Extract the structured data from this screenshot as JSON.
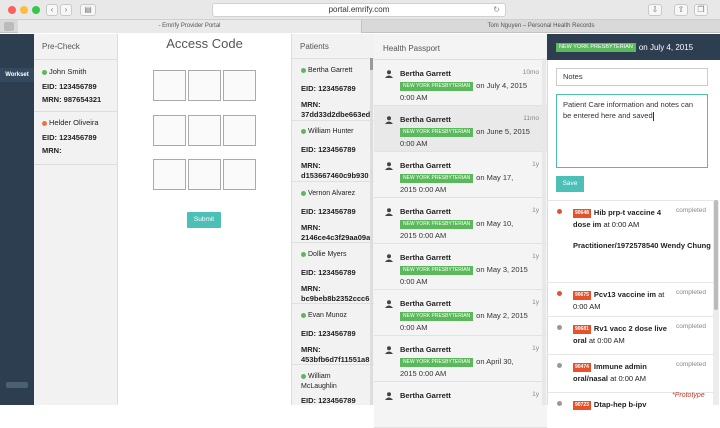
{
  "browser": {
    "url": "portal.emrify.com",
    "tabs": [
      "- Emrify Provider Portal",
      "Tom Nguyen – Personal Health Records"
    ]
  },
  "sidebar": {
    "workset_label": "Workset"
  },
  "precheck": {
    "title": "Pre-Check",
    "patients": [
      {
        "name": "John Smith",
        "status_color": "#5cb85c",
        "eid": "EID: 123456789",
        "mrn": "MRN: 987654321"
      },
      {
        "name": "Helder Oliveira",
        "status_color": "#e8734a",
        "eid": "EID: 123456789",
        "mrn": "MRN:"
      }
    ]
  },
  "access_code": {
    "title": "Access Code",
    "submit_label": "Submit"
  },
  "patients": {
    "title": "Patients",
    "items": [
      {
        "name": "Bertha Garrett",
        "eid": "EID: 123456789",
        "mrn": "MRN:\n37dd33d2dbe663ed"
      },
      {
        "name": "William Hunter",
        "eid": "EID: 123456789",
        "mrn": "MRN:\nd153667460c9b930"
      },
      {
        "name": "Vernon Alvarez",
        "eid": "EID: 123456789",
        "mrn": "MRN:\n2146ce4c3f29aa09a"
      },
      {
        "name": "Dollie Myers",
        "eid": "EID: 123456789",
        "mrn": "MRN:\nbc9beb8b2352ccc6"
      },
      {
        "name": "Evan Munoz",
        "eid": "EID: 123456789",
        "mrn": "MRN:\n453bfb6d7f11551a8"
      },
      {
        "name": "William\nMcLaughlin",
        "eid": "EID: 123456789",
        "mrn": ""
      }
    ]
  },
  "health_passport": {
    "title": "Health Passport",
    "items": [
      {
        "name": "Bertha Garrett",
        "ago": "10mo",
        "org": "NEW YORK PRESBYTERIAN",
        "line1": "on July 4, 2015",
        "line2": "0:00 AM"
      },
      {
        "name": "Bertha Garrett",
        "ago": "11mo",
        "org": "NEW YORK PRESBYTERIAN",
        "line1": "on June 5, 2015",
        "line2": "0:00 AM"
      },
      {
        "name": "Bertha Garrett",
        "ago": "1y",
        "org": "NEW YORK PRESBYTERIAN",
        "line1": "on May 17,",
        "line2": "2015 0:00 AM"
      },
      {
        "name": "Bertha Garrett",
        "ago": "1y",
        "org": "NEW YORK PRESBYTERIAN",
        "line1": "on May 10,",
        "line2": "2015 0:00 AM"
      },
      {
        "name": "Bertha Garrett",
        "ago": "1y",
        "org": "NEW YORK PRESBYTERIAN",
        "line1": "on May 3, 2015",
        "line2": "0:00 AM"
      },
      {
        "name": "Bertha Garrett",
        "ago": "1y",
        "org": "NEW YORK PRESBYTERIAN",
        "line1": "on May 2, 2015",
        "line2": "0:00 AM"
      },
      {
        "name": "Bertha Garrett",
        "ago": "1y",
        "org": "NEW YORK PRESBYTERIAN",
        "line1": "on April 30,",
        "line2": "2015 0:00 AM"
      },
      {
        "name": "Bertha Garrett",
        "ago": "1y",
        "org": "",
        "line1": "",
        "line2": ""
      }
    ]
  },
  "detail": {
    "org": "NEW YORK PRESBYTERIAN",
    "date": "on July 4, 2015",
    "notes_label": "Notes",
    "notes_text": "Patient Care information and notes can be entered here and saved",
    "save_label": "Save",
    "records": [
      {
        "code": "90648",
        "title": "Hib prp-t vaccine 4 dose im",
        "time": "at 0:00 AM",
        "status": "completed",
        "dot": "#e8512a",
        "practitioner": "Practitioner/1972578540 Wendy Chung"
      },
      {
        "code": "90675",
        "title": "Pcv13 vaccine im",
        "time": "at 0:00 AM",
        "status": "completed",
        "dot": "#e8512a",
        "practitioner": ""
      },
      {
        "code": "90681",
        "title": "Rv1 vacc 2 dose live oral",
        "time": "at 0:00 AM",
        "status": "completed",
        "dot": "#999999",
        "practitioner": ""
      },
      {
        "code": "90474",
        "title": "Immune admin oral/nasal",
        "time": "at 0:00 AM",
        "status": "completed",
        "dot": "#999999",
        "practitioner": ""
      },
      {
        "code": "90723",
        "title": "Dtap-hep b-ipv",
        "time": "",
        "status": "",
        "dot": "#999999",
        "practitioner": ""
      }
    ]
  },
  "watermark": "*Prototype"
}
